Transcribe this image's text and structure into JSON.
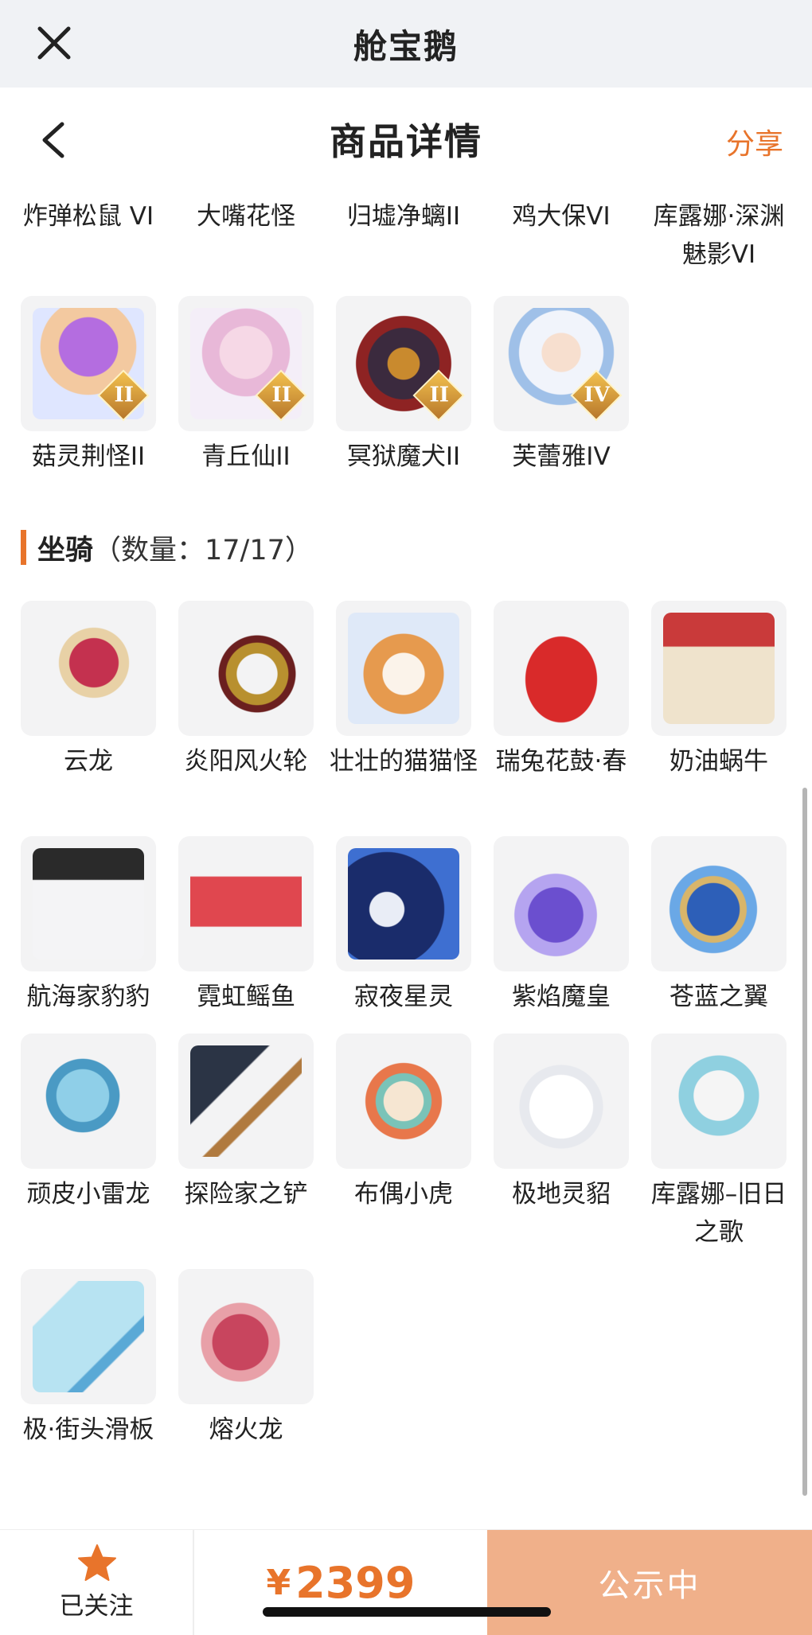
{
  "window_title": "舱宝鹅",
  "page_title": "商品详情",
  "share_label": "分享",
  "accent_color": "#e8742b",
  "partial_row": {
    "items": [
      {
        "name": "炸弹松鼠 VI"
      },
      {
        "name": "大嘴花怪"
      },
      {
        "name": "归墟净螭II"
      },
      {
        "name": "鸡大保VI"
      },
      {
        "name": "库露娜·深渊魅影VI"
      }
    ]
  },
  "pets_row": {
    "items": [
      {
        "name": "菇灵荆怪II",
        "badge": "II",
        "icon": "purple-mushroom-pet"
      },
      {
        "name": "青丘仙II",
        "badge": "II",
        "icon": "fox-fairy-pet"
      },
      {
        "name": "冥狱魔犬II",
        "badge": "II",
        "icon": "hell-dog-pet"
      },
      {
        "name": "芙蕾雅IV",
        "badge": "IV",
        "icon": "valkyrie-pet"
      }
    ]
  },
  "mounts_section": {
    "title": "坐骑",
    "count_text": "（数量：17/17）",
    "items": [
      {
        "name": "云龙",
        "icon": "cloud-dragon"
      },
      {
        "name": "炎阳风火轮",
        "icon": "fire-wheel"
      },
      {
        "name": "壮壮的猫猫怪",
        "icon": "chubby-cat"
      },
      {
        "name": "瑞兔花鼓·春",
        "icon": "rabbit-drum"
      },
      {
        "name": "奶油蜗牛",
        "icon": "cream-snail"
      },
      {
        "name": "航海家豹豹",
        "icon": "pirate-seal"
      },
      {
        "name": "霓虹鳐鱼",
        "icon": "neon-ray"
      },
      {
        "name": "寂夜星灵",
        "icon": "star-deer"
      },
      {
        "name": "紫焰魔皇",
        "icon": "purple-flame-bird"
      },
      {
        "name": "苍蓝之翼",
        "icon": "azure-griffin"
      },
      {
        "name": "顽皮小雷龙",
        "icon": "little-dino"
      },
      {
        "name": "探险家之铲",
        "icon": "explorer-shovel"
      },
      {
        "name": "布偶小虎",
        "icon": "cloth-tiger"
      },
      {
        "name": "极地灵貂",
        "icon": "polar-ferret"
      },
      {
        "name": "库露娜–旧日之歌",
        "icon": "cloud-sheep"
      },
      {
        "name": "极·街头滑板",
        "icon": "street-skateboard"
      },
      {
        "name": "熔火龙",
        "icon": "lava-dragon"
      }
    ]
  },
  "bottom_bar": {
    "follow_label": "已关注",
    "currency": "¥",
    "price": "2399",
    "status_label": "公示中"
  }
}
